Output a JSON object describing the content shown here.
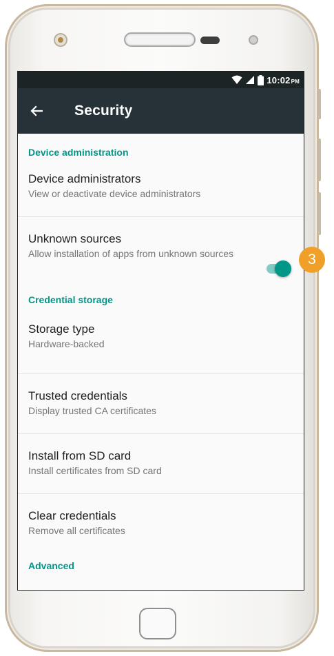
{
  "status_bar": {
    "time": "10:02",
    "ampm": "PM"
  },
  "app_bar": {
    "title": "Security"
  },
  "sections": {
    "device_administration": "Device administration",
    "credential_storage": "Credential storage",
    "advanced": "Advanced"
  },
  "items": {
    "device_administrators": {
      "title": "Device administrators",
      "subtitle": "View or deactivate device administrators"
    },
    "unknown_sources": {
      "title": "Unknown sources",
      "subtitle": "Allow installation of apps from unknown sources",
      "enabled": true
    },
    "storage_type": {
      "title": "Storage type",
      "subtitle": "Hardware-backed"
    },
    "trusted_credentials": {
      "title": "Trusted credentials",
      "subtitle": "Display trusted CA certificates"
    },
    "install_from_sd": {
      "title": "Install from SD card",
      "subtitle": "Install certificates from SD card"
    },
    "clear_credentials": {
      "title": "Clear credentials",
      "subtitle": "Remove all certificates"
    }
  },
  "callout": {
    "number": "3"
  },
  "colors": {
    "accent": "#009688",
    "toolbar": "#263238",
    "status_bar": "#1d2426",
    "callout": "#f0a029"
  }
}
